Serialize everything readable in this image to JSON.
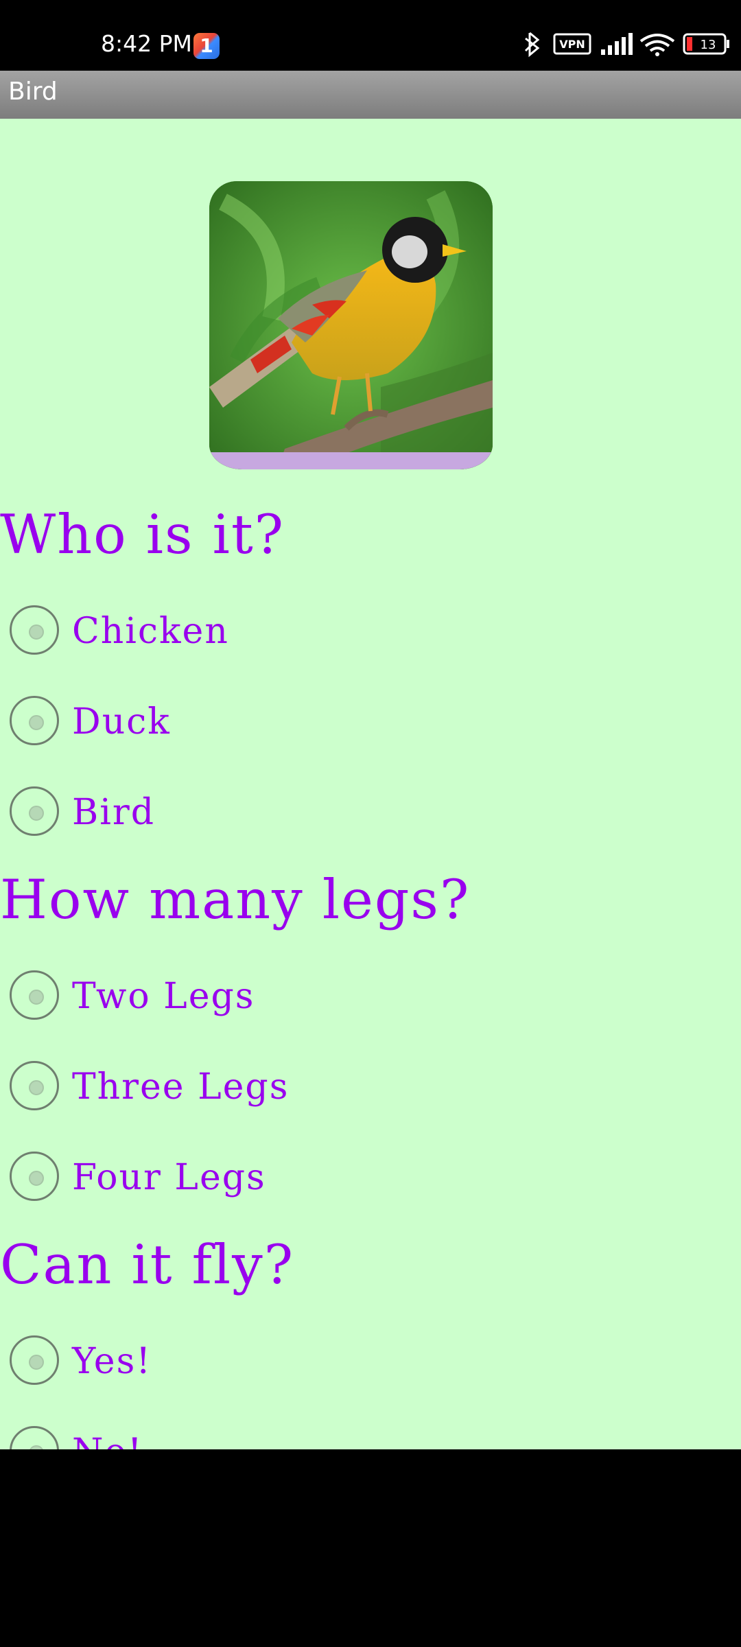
{
  "status_bar": {
    "time": "8:42 PM",
    "app_badge": "1",
    "vpn_label": "VPN",
    "battery": "13",
    "icons": [
      "bluetooth-icon",
      "vpn-icon",
      "signal-icon",
      "wifi-icon",
      "battery-icon"
    ]
  },
  "app": {
    "title": "Bird"
  },
  "image": {
    "subject": "bird-photo"
  },
  "questions": [
    {
      "text": "Who is it?",
      "options": [
        "Chicken",
        "Duck",
        "Bird"
      ]
    },
    {
      "text": "How many legs?",
      "options": [
        "Two Legs",
        "Three Legs",
        "Four Legs"
      ]
    },
    {
      "text": "Can it fly?",
      "options": [
        "Yes!",
        "No!"
      ]
    }
  ],
  "colors": {
    "background": "#ccffcc",
    "accent": "#9900ee",
    "title_bar": "#8c8c8c",
    "radio_border": "#6f7f6f"
  }
}
